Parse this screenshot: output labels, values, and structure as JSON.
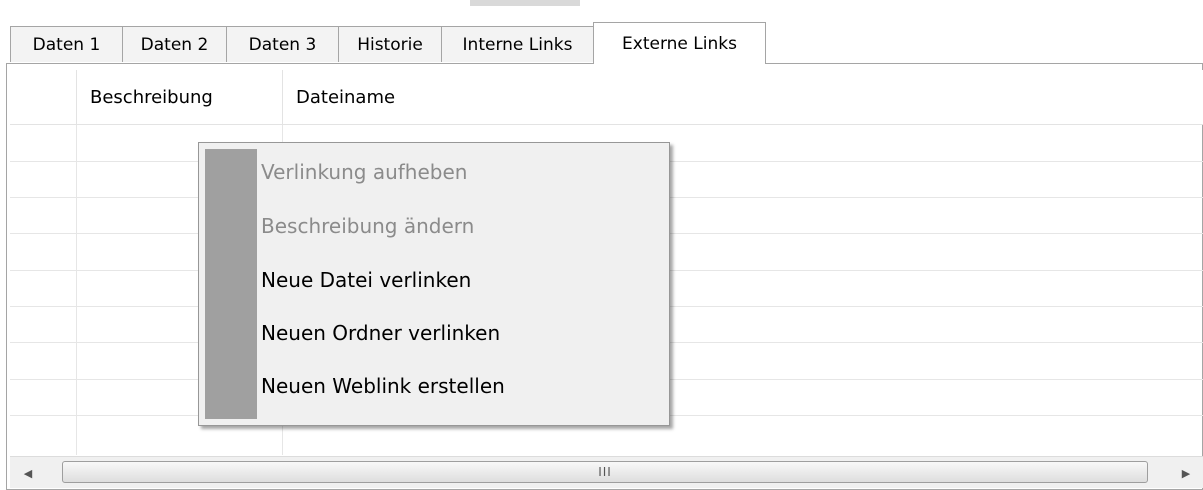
{
  "tabs": [
    {
      "label": "Daten 1",
      "active": false
    },
    {
      "label": "Daten 2",
      "active": false
    },
    {
      "label": "Daten 3",
      "active": false
    },
    {
      "label": "Historie",
      "active": false
    },
    {
      "label": "Interne Links",
      "active": false
    },
    {
      "label": "Externe Links",
      "active": true
    }
  ],
  "grid": {
    "columns": [
      "Beschreibung",
      "Dateiname"
    ],
    "rows": []
  },
  "scrollbar": {
    "left_arrow": "◀",
    "right_arrow": "▶",
    "grip": "III"
  },
  "context_menu": {
    "items": [
      {
        "label": "Verlinkung aufheben",
        "enabled": false
      },
      {
        "label": "Beschreibung ändern",
        "enabled": false
      },
      {
        "label": "Neue Datei verlinken",
        "enabled": true
      },
      {
        "label": "Neuen Ordner verlinken",
        "enabled": true
      },
      {
        "label": "Neuen Weblink erstellen",
        "enabled": true
      }
    ]
  }
}
